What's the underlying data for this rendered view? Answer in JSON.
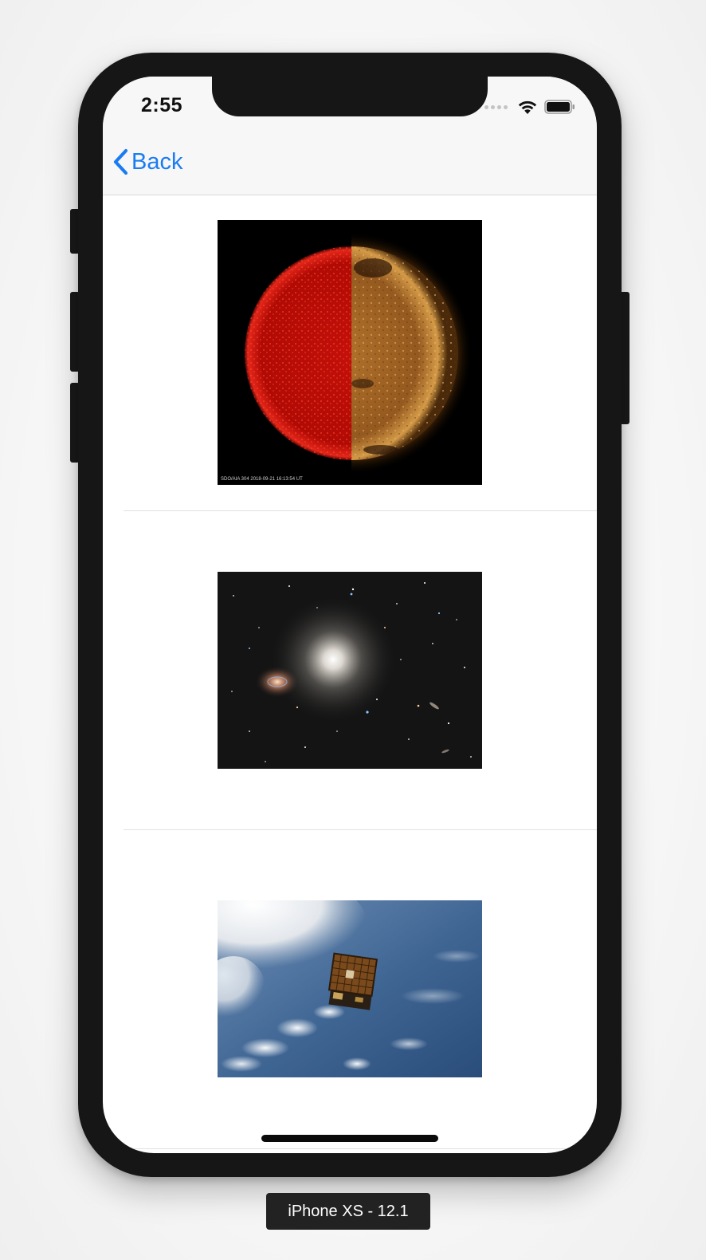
{
  "status_bar": {
    "time": "2:55",
    "icons": [
      "cellular-signal-icon",
      "wifi-icon",
      "battery-icon"
    ]
  },
  "nav_bar": {
    "back_label": "Back",
    "back_icon": "chevron-left-icon",
    "accent_color": "#1a7cf2"
  },
  "list": {
    "items": [
      {
        "image_subject": "sun-solar-observation",
        "caption": "SDO/AIA   304      2018-09-21  16:13:54  UT"
      },
      {
        "image_subject": "galaxy-deep-space"
      },
      {
        "image_subject": "satellite-over-earth"
      }
    ]
  },
  "simulator": {
    "device_label": "iPhone XS - 12.1"
  }
}
